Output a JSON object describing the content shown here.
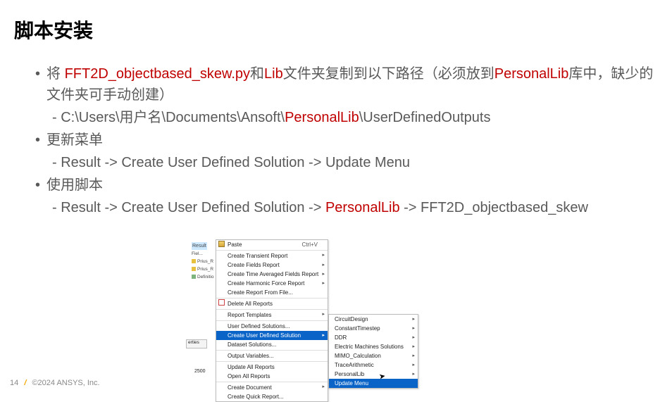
{
  "title": "脚本安装",
  "bullets": {
    "b1a": "将 ",
    "b1_py": "FFT2D_objectbased_skew.py",
    "b1b": "和",
    "b1_lib": "Lib",
    "b1c": "文件夹复制到以下路径（必须放到",
    "b1_pl": "PersonalLib",
    "b1d": "库中，缺少的文件夹可手动创建）",
    "sub1a": "‐ C:\\Users\\用户名\\Documents\\Ansoft\\",
    "sub1_pl": "PersonalLib",
    "sub1b": "\\UserDefinedOutputs",
    "b2": "更新菜单",
    "sub2": "‐ Result -> Create User Defined Solution -> Update Menu",
    "b3": "使用脚本",
    "sub3a": "‐ Result -> Create User Defined Solution -> ",
    "sub3_pl": "PersonalLib",
    "sub3b": " -> FFT2D_objectbased_skew"
  },
  "tree": {
    "result": "Result",
    "r1": "Fiel...",
    "r2": "Prius_R",
    "r3": "Prius_R",
    "r4": "Definitio",
    "erties": "erties",
    "num": "2500"
  },
  "menu1": {
    "paste": "Paste",
    "paste_short": "Ctrl+V",
    "ctr": "Create Transient Report",
    "cfr": "Create Fields Report",
    "ctafr": "Create Time Averaged Fields Report",
    "chfr": "Create Harmonic Force Report",
    "crff": "Create Report From File...",
    "dar": "Delete All Reports",
    "rt": "Report Templates",
    "uds": "User Defined Solutions...",
    "cuds": "Create User Defined Solution",
    "ds": "Dataset Solutions...",
    "ov": "Output Variables...",
    "uar": "Update All Reports",
    "oar": "Open All Reports",
    "cd": "Create Document",
    "cqr": "Create Quick Report..."
  },
  "menu2": {
    "cd": "CircuitDesign",
    "ct": "ConstantTimestep",
    "ddr": "DDR",
    "ems": "Electric Machines Solutions",
    "mimo": "MIMO_Calculation",
    "ta": "TraceArithmetic",
    "pl": "PersonalLib",
    "um": "Update Menu"
  },
  "footer": {
    "pagenum": "14",
    "copyright": "©2024 ANSYS, Inc."
  }
}
